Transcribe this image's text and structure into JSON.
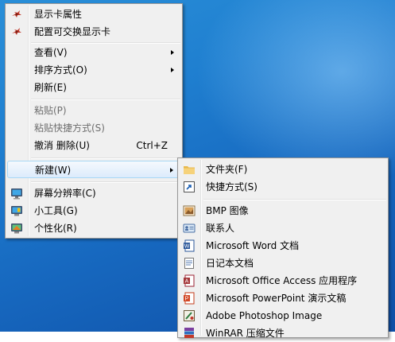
{
  "context_menu": {
    "items": [
      {
        "label": "显示卡属性",
        "icon": "graphics-properties-icon"
      },
      {
        "label": "配置可交换显示卡",
        "icon": "switchable-graphics-icon"
      },
      {
        "label": "查看(V)",
        "submenu": true
      },
      {
        "label": "排序方式(O)",
        "submenu": true
      },
      {
        "label": "刷新(E)"
      },
      {
        "label": "粘贴(P)",
        "disabled": true
      },
      {
        "label": "粘贴快捷方式(S)",
        "disabled": true
      },
      {
        "label": "撤消 删除(U)",
        "shortcut": "Ctrl+Z"
      },
      {
        "label": "新建(W)",
        "submenu": true,
        "highlighted": true
      },
      {
        "label": "屏幕分辨率(C)",
        "icon": "screen-resolution-icon"
      },
      {
        "label": "小工具(G)",
        "icon": "gadgets-icon"
      },
      {
        "label": "个性化(R)",
        "icon": "personalize-icon"
      }
    ]
  },
  "new_submenu": {
    "items": [
      {
        "label": "文件夹(F)",
        "icon": "folder-icon"
      },
      {
        "label": "快捷方式(S)",
        "icon": "shortcut-icon"
      },
      {
        "label": "BMP 图像",
        "icon": "bmp-image-icon"
      },
      {
        "label": "联系人",
        "icon": "contact-icon"
      },
      {
        "label": "Microsoft Word 文档",
        "icon": "word-document-icon"
      },
      {
        "label": "日记本文档",
        "icon": "journal-document-icon"
      },
      {
        "label": "Microsoft Office Access 应用程序",
        "icon": "access-icon"
      },
      {
        "label": "Microsoft PowerPoint 演示文稿",
        "icon": "powerpoint-icon"
      },
      {
        "label": "Adobe Photoshop Image",
        "icon": "photoshop-icon"
      },
      {
        "label": "WinRAR 压缩文件",
        "icon": "winrar-icon"
      }
    ]
  }
}
